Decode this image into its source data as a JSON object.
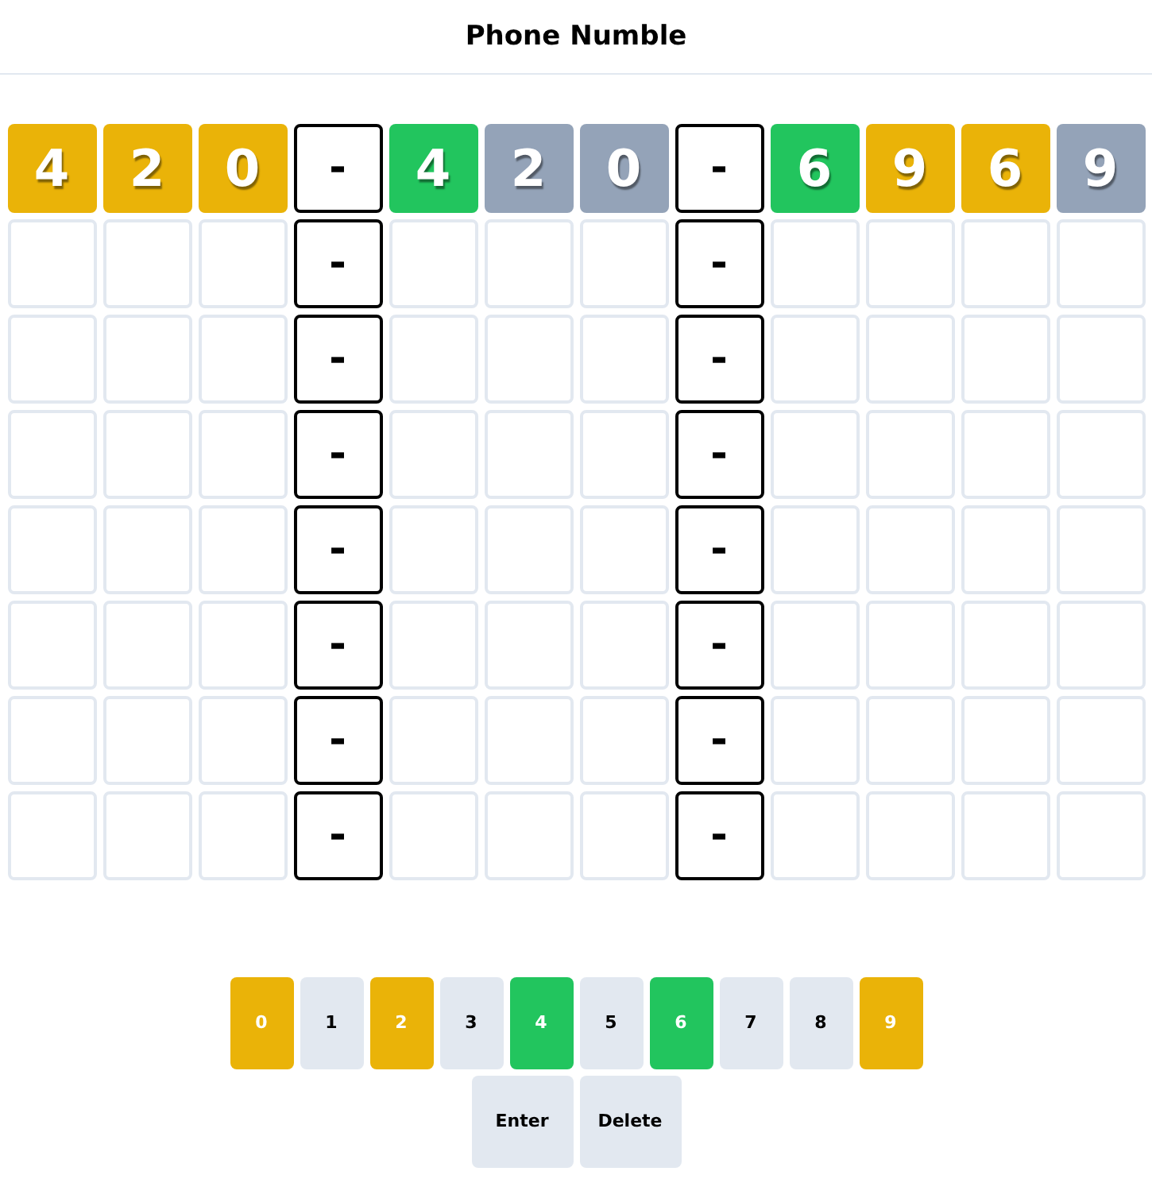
{
  "header": {
    "title": "Phone Numble"
  },
  "rows": [
    {
      "cells": [
        {
          "kind": "digit",
          "text": "4",
          "color": "#eab308"
        },
        {
          "kind": "digit",
          "text": "2",
          "color": "#eab308"
        },
        {
          "kind": "digit",
          "text": "0",
          "color": "#eab308"
        },
        {
          "kind": "dash",
          "text": "-"
        },
        {
          "kind": "digit",
          "text": "4",
          "color": "#22c55e"
        },
        {
          "kind": "digit",
          "text": "2",
          "color": "#94a3b8"
        },
        {
          "kind": "digit",
          "text": "0",
          "color": "#94a3b8"
        },
        {
          "kind": "dash",
          "text": "-"
        },
        {
          "kind": "digit",
          "text": "6",
          "color": "#22c55e"
        },
        {
          "kind": "digit",
          "text": "9",
          "color": "#eab308"
        },
        {
          "kind": "digit",
          "text": "6",
          "color": "#eab308"
        },
        {
          "kind": "digit",
          "text": "9",
          "color": "#94a3b8"
        }
      ]
    },
    {
      "cells": [
        {
          "kind": "empty"
        },
        {
          "kind": "empty"
        },
        {
          "kind": "empty"
        },
        {
          "kind": "dash",
          "text": "-"
        },
        {
          "kind": "empty"
        },
        {
          "kind": "empty"
        },
        {
          "kind": "empty"
        },
        {
          "kind": "dash",
          "text": "-"
        },
        {
          "kind": "empty"
        },
        {
          "kind": "empty"
        },
        {
          "kind": "empty"
        },
        {
          "kind": "empty"
        }
      ]
    },
    {
      "cells": [
        {
          "kind": "empty"
        },
        {
          "kind": "empty"
        },
        {
          "kind": "empty"
        },
        {
          "kind": "dash",
          "text": "-"
        },
        {
          "kind": "empty"
        },
        {
          "kind": "empty"
        },
        {
          "kind": "empty"
        },
        {
          "kind": "dash",
          "text": "-"
        },
        {
          "kind": "empty"
        },
        {
          "kind": "empty"
        },
        {
          "kind": "empty"
        },
        {
          "kind": "empty"
        }
      ]
    },
    {
      "cells": [
        {
          "kind": "empty"
        },
        {
          "kind": "empty"
        },
        {
          "kind": "empty"
        },
        {
          "kind": "dash",
          "text": "-"
        },
        {
          "kind": "empty"
        },
        {
          "kind": "empty"
        },
        {
          "kind": "empty"
        },
        {
          "kind": "dash",
          "text": "-"
        },
        {
          "kind": "empty"
        },
        {
          "kind": "empty"
        },
        {
          "kind": "empty"
        },
        {
          "kind": "empty"
        }
      ]
    },
    {
      "cells": [
        {
          "kind": "empty"
        },
        {
          "kind": "empty"
        },
        {
          "kind": "empty"
        },
        {
          "kind": "dash",
          "text": "-"
        },
        {
          "kind": "empty"
        },
        {
          "kind": "empty"
        },
        {
          "kind": "empty"
        },
        {
          "kind": "dash",
          "text": "-"
        },
        {
          "kind": "empty"
        },
        {
          "kind": "empty"
        },
        {
          "kind": "empty"
        },
        {
          "kind": "empty"
        }
      ]
    },
    {
      "cells": [
        {
          "kind": "empty"
        },
        {
          "kind": "empty"
        },
        {
          "kind": "empty"
        },
        {
          "kind": "dash",
          "text": "-"
        },
        {
          "kind": "empty"
        },
        {
          "kind": "empty"
        },
        {
          "kind": "empty"
        },
        {
          "kind": "dash",
          "text": "-"
        },
        {
          "kind": "empty"
        },
        {
          "kind": "empty"
        },
        {
          "kind": "empty"
        },
        {
          "kind": "empty"
        }
      ]
    },
    {
      "cells": [
        {
          "kind": "empty"
        },
        {
          "kind": "empty"
        },
        {
          "kind": "empty"
        },
        {
          "kind": "dash",
          "text": "-"
        },
        {
          "kind": "empty"
        },
        {
          "kind": "empty"
        },
        {
          "kind": "empty"
        },
        {
          "kind": "dash",
          "text": "-"
        },
        {
          "kind": "empty"
        },
        {
          "kind": "empty"
        },
        {
          "kind": "empty"
        },
        {
          "kind": "empty"
        }
      ]
    },
    {
      "cells": [
        {
          "kind": "empty"
        },
        {
          "kind": "empty"
        },
        {
          "kind": "empty"
        },
        {
          "kind": "dash",
          "text": "-"
        },
        {
          "kind": "empty"
        },
        {
          "kind": "empty"
        },
        {
          "kind": "empty"
        },
        {
          "kind": "dash",
          "text": "-"
        },
        {
          "kind": "empty"
        },
        {
          "kind": "empty"
        },
        {
          "kind": "empty"
        },
        {
          "kind": "empty"
        }
      ]
    }
  ],
  "keyboard": {
    "digit_keys": [
      {
        "label": "0",
        "color": "#eab308"
      },
      {
        "label": "1",
        "color": "#e2e8f0"
      },
      {
        "label": "2",
        "color": "#eab308"
      },
      {
        "label": "3",
        "color": "#e2e8f0"
      },
      {
        "label": "4",
        "color": "#22c55e"
      },
      {
        "label": "5",
        "color": "#e2e8f0"
      },
      {
        "label": "6",
        "color": "#22c55e"
      },
      {
        "label": "7",
        "color": "#e2e8f0"
      },
      {
        "label": "8",
        "color": "#e2e8f0"
      },
      {
        "label": "9",
        "color": "#eab308"
      }
    ],
    "action_keys": [
      {
        "label": "Enter"
      },
      {
        "label": "Delete"
      }
    ]
  }
}
